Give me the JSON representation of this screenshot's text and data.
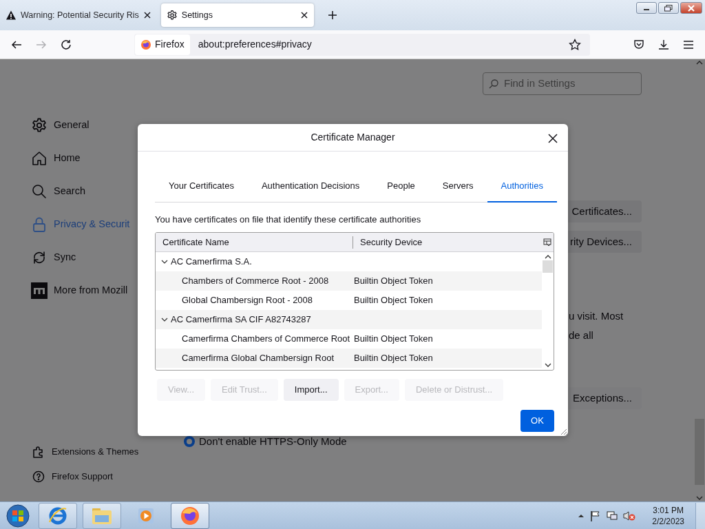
{
  "browser": {
    "tabs": [
      {
        "title": "Warning: Potential Security Ris",
        "selected": false
      },
      {
        "title": "Settings",
        "selected": true
      }
    ],
    "identity": "Firefox",
    "url": "about:preferences#privacy",
    "forward_disabled": true
  },
  "settings": {
    "search": {
      "placeholder": "Find in Settings"
    },
    "sidebar": [
      {
        "label": "General",
        "selected": false
      },
      {
        "label": "Home",
        "selected": false
      },
      {
        "label": "Search",
        "selected": false
      },
      {
        "label": "Privacy & Securit",
        "selected": true
      },
      {
        "label": "Sync",
        "selected": false
      },
      {
        "label": "More from Mozill",
        "selected": false
      }
    ],
    "footer_links": [
      "Extensions & Themes",
      "Firefox Support"
    ],
    "background_buttons": [
      "Certificates...",
      "rity Devices..."
    ],
    "background_text": [
      "u visit. Most",
      "de all"
    ],
    "exceptions_button": "Exceptions...",
    "https_option": {
      "label": "Don't enable HTTPS-Only Mode",
      "checked": true
    }
  },
  "dialog": {
    "title": "Certificate Manager",
    "tabs": [
      {
        "label": "Your Certificates",
        "selected": false
      },
      {
        "label": "Authentication Decisions",
        "selected": false
      },
      {
        "label": "People",
        "selected": false
      },
      {
        "label": "Servers",
        "selected": false
      },
      {
        "label": "Authorities",
        "selected": true
      }
    ],
    "description": "You have certificates on file that identify these certificate authorities",
    "columns": [
      "Certificate Name",
      "Security Device"
    ],
    "tree": [
      {
        "name": "AC Camerfirma S.A.",
        "expanded": true,
        "children": [
          {
            "name": "Chambers of Commerce Root - 2008",
            "device": "Builtin Object Token"
          },
          {
            "name": "Global Chambersign Root - 2008",
            "device": "Builtin Object Token"
          }
        ]
      },
      {
        "name": "AC Camerfirma SA CIF A82743287",
        "expanded": true,
        "children": [
          {
            "name": "Camerfirma Chambers of Commerce Root",
            "device": "Builtin Object Token"
          },
          {
            "name": "Camerfirma Global Chambersign Root",
            "device": "Builtin Object Token"
          }
        ]
      }
    ],
    "buttons": [
      {
        "label": "View...",
        "disabled": true
      },
      {
        "label": "Edit Trust...",
        "disabled": true
      },
      {
        "label": "Import...",
        "disabled": false
      },
      {
        "label": "Export...",
        "disabled": true
      },
      {
        "label": "Delete or Distrust...",
        "disabled": true
      }
    ],
    "ok": "OK"
  },
  "taskbar": {
    "apps": [
      {
        "selected": false
      },
      {
        "selected": false
      },
      {
        "selected": false
      },
      {
        "selected": true
      }
    ],
    "time": "3:01 PM",
    "date": "2/2/2023"
  }
}
